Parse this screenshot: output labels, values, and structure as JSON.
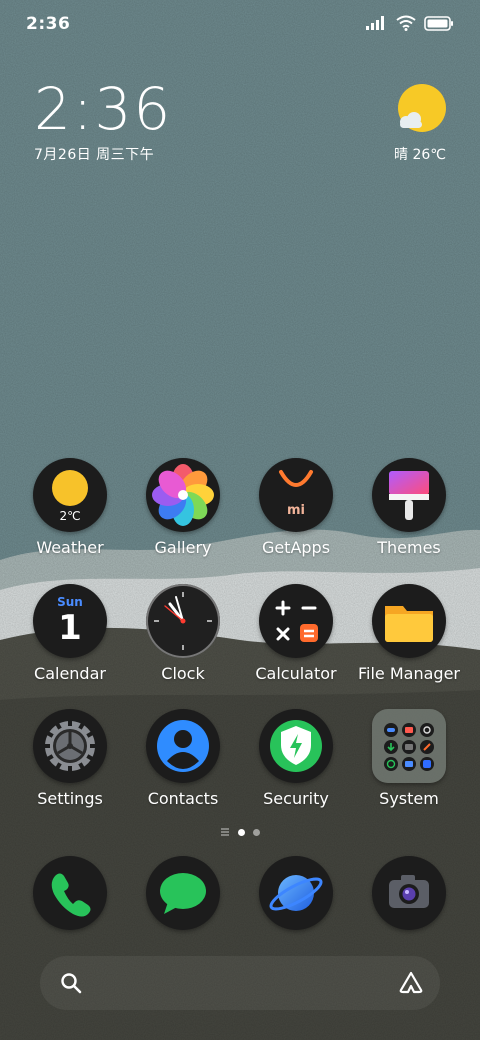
{
  "status_bar": {
    "time": "2:36",
    "icons": [
      "signal-icon",
      "wifi-icon",
      "battery-icon"
    ]
  },
  "clock_widget": {
    "time": "2:36",
    "date": "7月26日 周三下午"
  },
  "weather_widget": {
    "condition_temp": "晴 26℃",
    "icon": "sun-cloud-icon"
  },
  "home_grid": [
    {
      "label": "Weather",
      "icon": "weather-icon",
      "badge": "2℃"
    },
    {
      "label": "Gallery",
      "icon": "gallery-icon"
    },
    {
      "label": "GetApps",
      "icon": "getapps-icon",
      "badge": "mi"
    },
    {
      "label": "Themes",
      "icon": "themes-icon"
    },
    {
      "label": "Calendar",
      "icon": "calendar-icon",
      "day_name": "Sun",
      "day_number": "1"
    },
    {
      "label": "Clock",
      "icon": "clock-icon"
    },
    {
      "label": "Calculator",
      "icon": "calculator-icon"
    },
    {
      "label": "File Manager",
      "icon": "folder-icon"
    },
    {
      "label": "Settings",
      "icon": "gear-icon"
    },
    {
      "label": "Contacts",
      "icon": "contact-icon"
    },
    {
      "label": "Security",
      "icon": "shield-icon"
    },
    {
      "label": "System",
      "icon": "folder-grid-icon"
    }
  ],
  "page_indicator": {
    "pages": 2,
    "active": 1
  },
  "dock": [
    {
      "name": "phone",
      "icon": "phone-icon"
    },
    {
      "name": "messages",
      "icon": "message-icon"
    },
    {
      "name": "browser",
      "icon": "planet-icon"
    },
    {
      "name": "camera",
      "icon": "camera-icon"
    }
  ],
  "search_bar": {
    "left_icon": "search-icon",
    "right_icon": "assistant-icon"
  },
  "colors": {
    "sky": "#6f8b8f",
    "hill_light": "#d9dede",
    "ground": "#4f5048",
    "sun": "#f7c926"
  }
}
